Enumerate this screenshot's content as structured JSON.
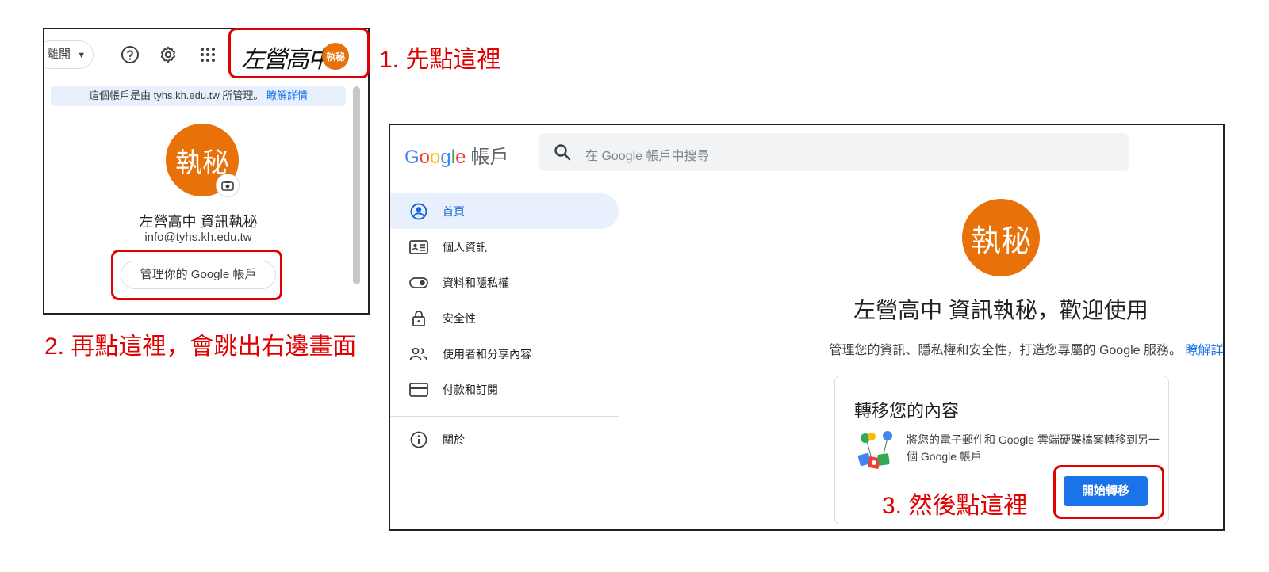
{
  "popup_topbar": {
    "leave_label": "離開",
    "help_icon": "help-circle-icon",
    "settings_icon": "gear-icon",
    "apps_icon": "apps-grid-icon",
    "signature_logo": "左營高中",
    "avatar_text": "執秘"
  },
  "popup": {
    "managed_text": "這個帳戶是由 tyhs.kh.edu.tw 所管理。",
    "learn_more": "瞭解詳情",
    "avatar_text": "執秘",
    "name": "左營高中 資訊執秘",
    "email": "info@tyhs.kh.edu.tw",
    "manage_button": "管理你的 Google 帳戶"
  },
  "annotations": {
    "step1": "1. 先點這裡",
    "step2": "2. 再點這裡，會跳出右邊畫面",
    "step3": "3. 然後點這裡"
  },
  "account": {
    "logo_letters": [
      "G",
      "o",
      "o",
      "g",
      "l",
      "e"
    ],
    "logo_suffix": "帳戶",
    "search_placeholder": "在 Google 帳戶中搜尋",
    "nav": [
      {
        "label": "首頁",
        "icon": "home-account-icon",
        "active": true
      },
      {
        "label": "個人資訊",
        "icon": "id-card-icon",
        "active": false
      },
      {
        "label": "資料和隱私權",
        "icon": "toggle-icon",
        "active": false
      },
      {
        "label": "安全性",
        "icon": "lock-icon",
        "active": false
      },
      {
        "label": "使用者和分享內容",
        "icon": "people-icon",
        "active": false
      },
      {
        "label": "付款和訂閱",
        "icon": "credit-card-icon",
        "active": false
      },
      {
        "label": "關於",
        "icon": "info-icon",
        "active": false
      }
    ],
    "avatar_text": "執秘",
    "welcome": "左營高中 資訊執秘，歡迎使用",
    "subtitle": "管理您的資訊、隱私權和安全性，打造您專屬的 Google 服務。",
    "subtitle_link": "瞭解詳情",
    "card": {
      "title": "轉移您的內容",
      "description": "將您的電子郵件和 Google 雲端硬碟檔案轉移到另一個 Google 帳戶",
      "button": "開始轉移"
    }
  },
  "colors": {
    "accent": "#1a73e8",
    "avatar": "#e8710a",
    "highlight": "#e00000"
  }
}
